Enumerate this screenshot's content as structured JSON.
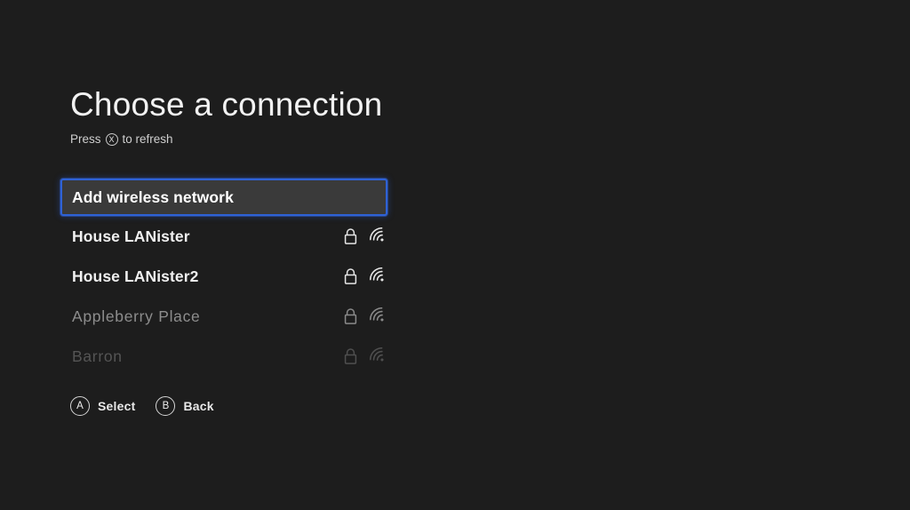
{
  "screen": {
    "background_color": "#1d1d1d",
    "title": "Choose a connection",
    "subtitle_prefix": "Press",
    "subtitle_glyph": "x-button-glyph",
    "subtitle_glyph_label": "X",
    "subtitle_suffix": "to refresh"
  },
  "theme": {
    "accent_color": "#2f62d6",
    "selected_fill": "#3a3a3a",
    "text_primary": "#f0f0f0",
    "text_dim": "#8d8d8d",
    "text_dimmer": "#555555"
  },
  "network_list": {
    "items": [
      {
        "label": "Add wireless network",
        "state": "selected",
        "has_lock": false,
        "has_wifi": false,
        "signal_bars": 0
      },
      {
        "label": "House LANister",
        "state": "normal",
        "has_lock": true,
        "has_wifi": true,
        "signal_bars": 3
      },
      {
        "label": "House LANister2",
        "state": "normal",
        "has_lock": true,
        "has_wifi": true,
        "signal_bars": 3
      },
      {
        "label": "Appleberry Place",
        "state": "dim",
        "has_lock": true,
        "has_wifi": true,
        "signal_bars": 3
      },
      {
        "label": "Barron",
        "state": "dimmer",
        "has_lock": true,
        "has_wifi": true,
        "signal_bars": 3
      }
    ]
  },
  "actions": [
    {
      "glyph": "A",
      "glyph_name": "a-button-glyph",
      "label": "Select"
    },
    {
      "glyph": "B",
      "glyph_name": "b-button-glyph",
      "label": "Back"
    }
  ]
}
